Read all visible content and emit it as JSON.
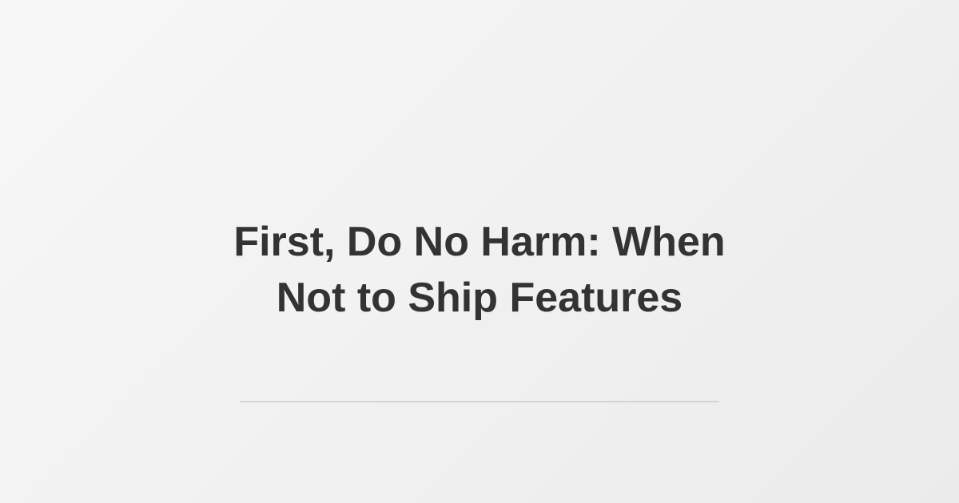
{
  "title_line_1": "First, Do No Harm: When",
  "title_line_2": "Not to Ship Features",
  "colors": {
    "title_text": "#333333",
    "divider": "#d5d5d5",
    "background": "#f1f1f1"
  }
}
